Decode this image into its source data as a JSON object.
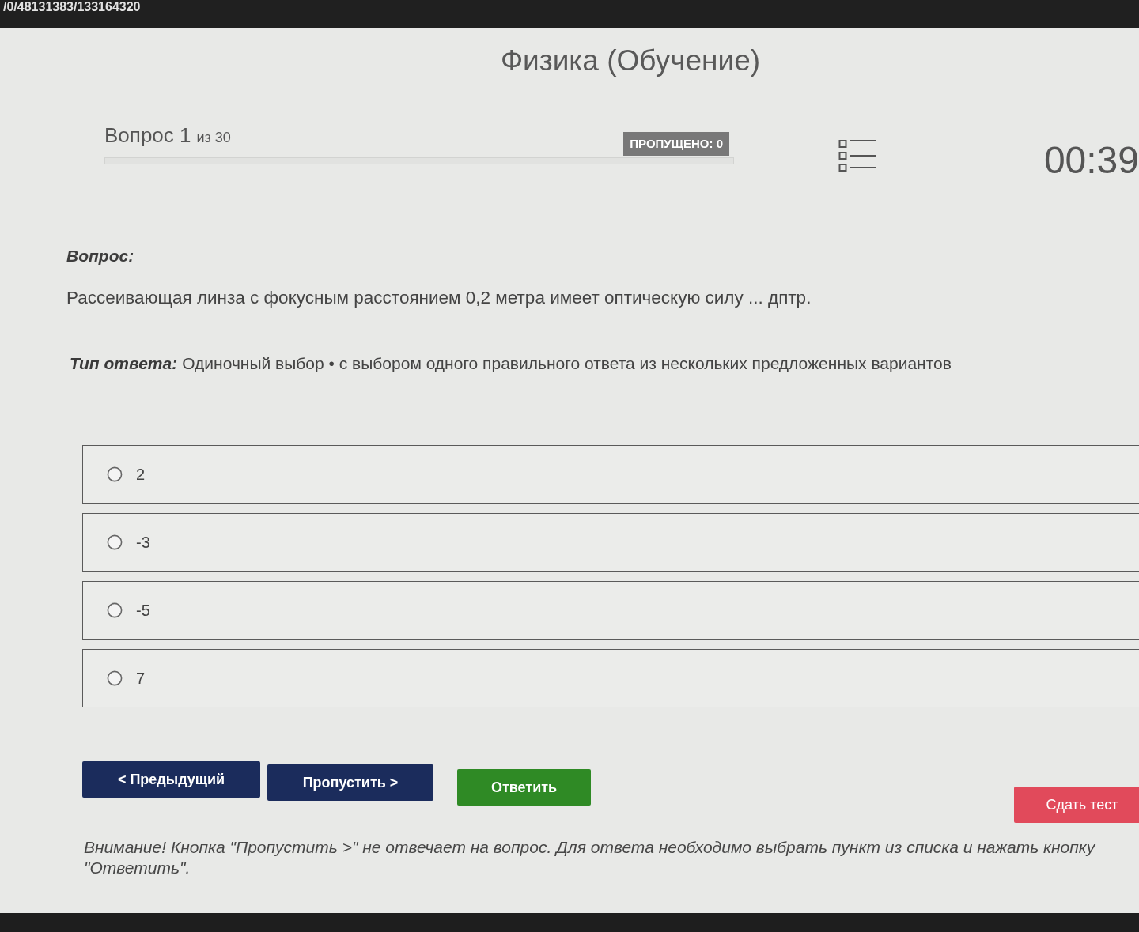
{
  "address_bar": {
    "text": "/0/48131383/133164320"
  },
  "title": "Физика (Обучение)",
  "header": {
    "question_label": "Вопрос 1",
    "question_total": "из 30",
    "skipped_badge": "ПРОПУЩЕНО: 0",
    "timer": "00:39"
  },
  "question": {
    "heading": "Вопрос:",
    "text": "Рассеивающая линза с фокусным расстоянием 0,2 метра имеет оптическую силу ... дптр.",
    "answer_type_label": "Тип ответа:",
    "answer_type": "Одиночный выбор • с выбором одного правильного ответа из нескольких предложенных вариантов"
  },
  "options": [
    {
      "label": "2",
      "selected": false
    },
    {
      "label": "-3",
      "selected": false
    },
    {
      "label": "-5",
      "selected": false
    },
    {
      "label": "7",
      "selected": false
    }
  ],
  "buttons": [
    {
      "label": "< Предыдущий",
      "kind": "nav"
    },
    {
      "label": "Пропустить >",
      "kind": "nav"
    },
    {
      "label": "Ответить",
      "kind": "answer"
    },
    {
      "label": "Сдать тест",
      "kind": "submit"
    }
  ],
  "notice": "Внимание! Кнопка \"Пропустить >\" не отвечает на вопрос. Для ответа необходимо выбрать пункт из списка и нажать кнопку \"Ответить\"."
}
